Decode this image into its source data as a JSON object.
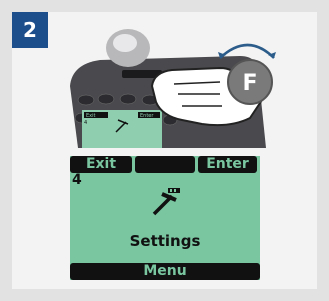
{
  "step": {
    "number": "2"
  },
  "device": {
    "function_key_label": "F",
    "mini_screen": {
      "left_key": "Exit",
      "right_key": "Enter",
      "number": "4"
    }
  },
  "lcd": {
    "left_softkey": "Exit",
    "middle_softkey": "",
    "right_softkey": "Enter",
    "item_number": "4",
    "item_label": "Settings",
    "bottom_softkey": "Menu"
  },
  "colors": {
    "badge": "#1d4e8c",
    "lcd_background": "#79c6a1",
    "f_button": "#7a7a7a"
  },
  "icons": {
    "lcd_icon": "hammer-wrench-icon",
    "finger_icon": "pointing-hand-icon",
    "rotate_arrow_icon": "curved-arrow-icon"
  }
}
